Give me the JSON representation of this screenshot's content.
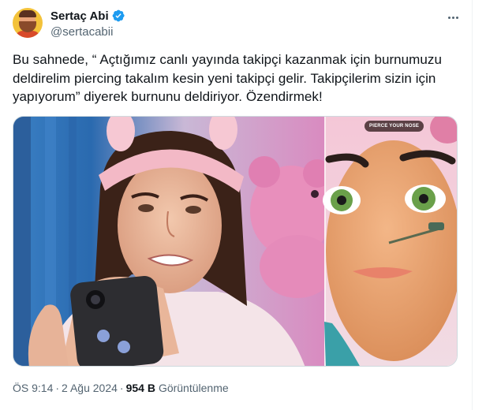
{
  "author": {
    "display_name": "Sertaç Abi",
    "handle": "@sertacabii",
    "verified_color": "#1d9bf0"
  },
  "tweet": {
    "text": "Bu sahnede, “ Açtığımız canlı yayında takipçi kazanmak için burnumuzu deldirelim piercing takalım kesin yeni takipçi gelir. Takipçilerim sizin için yapıyorum” diyerek burnunu deldiriyor. Özendirmek!"
  },
  "media": {
    "badge_text": "PIERCE YOUR NOSE"
  },
  "meta": {
    "time": "ÖS 9:14",
    "date": "2 Ağu 2024",
    "separator": "·",
    "views_count": "954 B",
    "views_label": "Görüntülenme"
  },
  "icons": {
    "more": "more-horizontal-icon",
    "verified": "verified-badge-icon"
  }
}
